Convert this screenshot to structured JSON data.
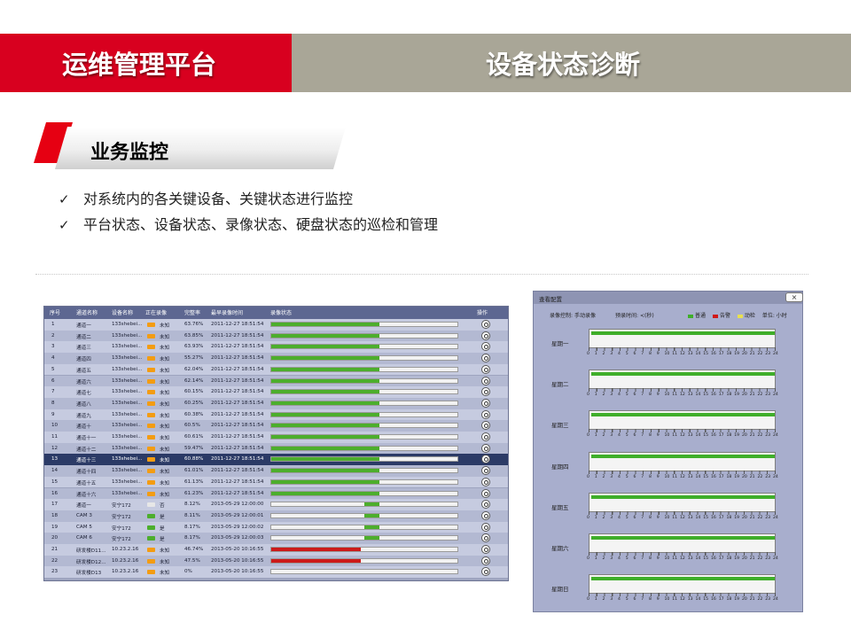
{
  "header": {
    "platform_title": "运维管理平台",
    "page_title": "设备状态诊断",
    "colors": {
      "red": "#d8001f",
      "gray": "#a9a697"
    }
  },
  "section": {
    "title": "业务监控",
    "bullets": [
      "对系统内的各关键设备、关键状态进行监控",
      "平台状态、设备状态、录像状态、硬盘状态的巡检和管理"
    ]
  },
  "table": {
    "columns": [
      "序号",
      "通道名称",
      "设备名称",
      "正在录像",
      "完整率",
      "最早录像时间",
      "录像状态",
      "操作"
    ],
    "selected_row": 13,
    "rows": [
      {
        "no": "1",
        "channel": "通道一",
        "device": "133shebei...",
        "recording": "未知",
        "rate": "63.76%",
        "time": "2011-12-27 18:51:54",
        "bar_start": 0.0,
        "bar_end": 0.58,
        "bar_color": "#4cae2c",
        "rec_color": "#f39c12"
      },
      {
        "no": "2",
        "channel": "通道二",
        "device": "133shebei...",
        "recording": "未知",
        "rate": "63.85%",
        "time": "2011-12-27 18:51:54",
        "bar_start": 0.0,
        "bar_end": 0.58,
        "bar_color": "#4cae2c",
        "rec_color": "#f39c12"
      },
      {
        "no": "3",
        "channel": "通道三",
        "device": "133shebei...",
        "recording": "未知",
        "rate": "63.93%",
        "time": "2011-12-27 18:51:54",
        "bar_start": 0.0,
        "bar_end": 0.58,
        "bar_color": "#4cae2c",
        "rec_color": "#f39c12"
      },
      {
        "no": "4",
        "channel": "通道四",
        "device": "133shebei...",
        "recording": "未知",
        "rate": "55.27%",
        "time": "2011-12-27 18:51:54",
        "bar_start": 0.0,
        "bar_end": 0.58,
        "bar_color": "#4cae2c",
        "rec_color": "#f39c12"
      },
      {
        "no": "5",
        "channel": "通道五",
        "device": "133shebei...",
        "recording": "未知",
        "rate": "62.04%",
        "time": "2011-12-27 18:51:54",
        "bar_start": 0.0,
        "bar_end": 0.58,
        "bar_color": "#4cae2c",
        "rec_color": "#f39c12"
      },
      {
        "no": "6",
        "channel": "通道六",
        "device": "133shebei...",
        "recording": "未知",
        "rate": "62.14%",
        "time": "2011-12-27 18:51:54",
        "bar_start": 0.0,
        "bar_end": 0.58,
        "bar_color": "#4cae2c",
        "rec_color": "#f39c12"
      },
      {
        "no": "7",
        "channel": "通道七",
        "device": "133shebei...",
        "recording": "未知",
        "rate": "60.15%",
        "time": "2011-12-27 18:51:54",
        "bar_start": 0.0,
        "bar_end": 0.58,
        "bar_color": "#4cae2c",
        "rec_color": "#f39c12"
      },
      {
        "no": "8",
        "channel": "通道八",
        "device": "133shebei...",
        "recording": "未知",
        "rate": "60.25%",
        "time": "2011-12-27 18:51:54",
        "bar_start": 0.0,
        "bar_end": 0.58,
        "bar_color": "#4cae2c",
        "rec_color": "#f39c12"
      },
      {
        "no": "9",
        "channel": "通道九",
        "device": "133shebei...",
        "recording": "未知",
        "rate": "60.38%",
        "time": "2011-12-27 18:51:54",
        "bar_start": 0.0,
        "bar_end": 0.58,
        "bar_color": "#4cae2c",
        "rec_color": "#f39c12"
      },
      {
        "no": "10",
        "channel": "通道十",
        "device": "133shebei...",
        "recording": "未知",
        "rate": "60.5%",
        "time": "2011-12-27 18:51:54",
        "bar_start": 0.0,
        "bar_end": 0.58,
        "bar_color": "#4cae2c",
        "rec_color": "#f39c12"
      },
      {
        "no": "11",
        "channel": "通道十一",
        "device": "133shebei...",
        "recording": "未知",
        "rate": "60.61%",
        "time": "2011-12-27 18:51:54",
        "bar_start": 0.0,
        "bar_end": 0.58,
        "bar_color": "#4cae2c",
        "rec_color": "#f39c12"
      },
      {
        "no": "12",
        "channel": "通道十二",
        "device": "133shebei...",
        "recording": "未知",
        "rate": "59.47%",
        "time": "2011-12-27 18:51:54",
        "bar_start": 0.0,
        "bar_end": 0.58,
        "bar_color": "#4cae2c",
        "rec_color": "#f39c12"
      },
      {
        "no": "13",
        "channel": "通道十三",
        "device": "133shebei...",
        "recording": "未知",
        "rate": "60.88%",
        "time": "2011-12-27 18:51:54",
        "bar_start": 0.0,
        "bar_end": 0.58,
        "bar_color": "#4cae2c",
        "rec_color": "#f39c12"
      },
      {
        "no": "14",
        "channel": "通道十四",
        "device": "133shebei...",
        "recording": "未知",
        "rate": "61.01%",
        "time": "2011-12-27 18:51:54",
        "bar_start": 0.0,
        "bar_end": 0.58,
        "bar_color": "#4cae2c",
        "rec_color": "#f39c12"
      },
      {
        "no": "15",
        "channel": "通道十五",
        "device": "133shebei...",
        "recording": "未知",
        "rate": "61.13%",
        "time": "2011-12-27 18:51:54",
        "bar_start": 0.0,
        "bar_end": 0.58,
        "bar_color": "#4cae2c",
        "rec_color": "#f39c12"
      },
      {
        "no": "16",
        "channel": "通道十六",
        "device": "133shebei...",
        "recording": "未知",
        "rate": "61.23%",
        "time": "2011-12-27 18:51:54",
        "bar_start": 0.0,
        "bar_end": 0.58,
        "bar_color": "#4cae2c",
        "rec_color": "#f39c12"
      },
      {
        "no": "17",
        "channel": "通道一",
        "device": "安宁172",
        "recording": "否",
        "rate": "8.12%",
        "time": "2013-05-29 12:00:00",
        "bar_start": 0.5,
        "bar_end": 0.58,
        "bar_color": "#4cae2c",
        "rec_color": "#e7e7e7"
      },
      {
        "no": "18",
        "channel": "CAM 3",
        "device": "安宁172",
        "recording": "是",
        "rate": "8.11%",
        "time": "2013-05-29 12:00:01",
        "bar_start": 0.5,
        "bar_end": 0.58,
        "bar_color": "#4cae2c",
        "rec_color": "#4cae2c"
      },
      {
        "no": "19",
        "channel": "CAM 5",
        "device": "安宁172",
        "recording": "是",
        "rate": "8.17%",
        "time": "2013-05-29 12:00:02",
        "bar_start": 0.5,
        "bar_end": 0.58,
        "bar_color": "#4cae2c",
        "rec_color": "#4cae2c"
      },
      {
        "no": "20",
        "channel": "CAM 6",
        "device": "安宁172",
        "recording": "是",
        "rate": "8.17%",
        "time": "2013-05-29 12:00:03",
        "bar_start": 0.5,
        "bar_end": 0.58,
        "bar_color": "#4cae2c",
        "rec_color": "#4cae2c"
      },
      {
        "no": "21",
        "channel": "研发楼D11...",
        "device": "10.23.2.16",
        "recording": "未知",
        "rate": "46.74%",
        "time": "2013-05-20 10:16:55",
        "bar_start": 0.0,
        "bar_end": 0.48,
        "bar_color": "#cc1a1a",
        "rec_color": "#f39c12"
      },
      {
        "no": "22",
        "channel": "研发楼D12...",
        "device": "10.23.2.16",
        "recording": "未知",
        "rate": "47.5%",
        "time": "2013-05-20 10:16:55",
        "bar_start": 0.0,
        "bar_end": 0.48,
        "bar_color": "#cc1a1a",
        "rec_color": "#f39c12"
      },
      {
        "no": "23",
        "channel": "研发楼D13",
        "device": "10.23.2.16",
        "recording": "未知",
        "rate": "0%",
        "time": "2013-05-20 10:16:55",
        "bar_start": 0.0,
        "bar_end": 0.0,
        "bar_color": "#4cae2c",
        "rec_color": "#f39c12"
      }
    ]
  },
  "config": {
    "title": "查看配置",
    "close": "×",
    "mode_label": "录像控制:",
    "mode_value": "手动录像",
    "pre_label": "预录时间:",
    "pre_value": "<(秒)",
    "legend": [
      {
        "label": "普通",
        "color": "#3fae2a"
      },
      {
        "label": "告警",
        "color": "#d01818"
      },
      {
        "label": "动检",
        "color": "#e8e050"
      }
    ],
    "unit_label": "单位: 小时",
    "days": [
      "星期一",
      "星期二",
      "星期三",
      "星期四",
      "星期五",
      "星期六",
      "星期日"
    ],
    "hours": [
      "0",
      "1",
      "2",
      "3",
      "4",
      "5",
      "6",
      "7",
      "8",
      "9",
      "10",
      "11",
      "12",
      "13",
      "14",
      "15",
      "16",
      "17",
      "18",
      "19",
      "20",
      "21",
      "22",
      "23",
      "24"
    ]
  }
}
